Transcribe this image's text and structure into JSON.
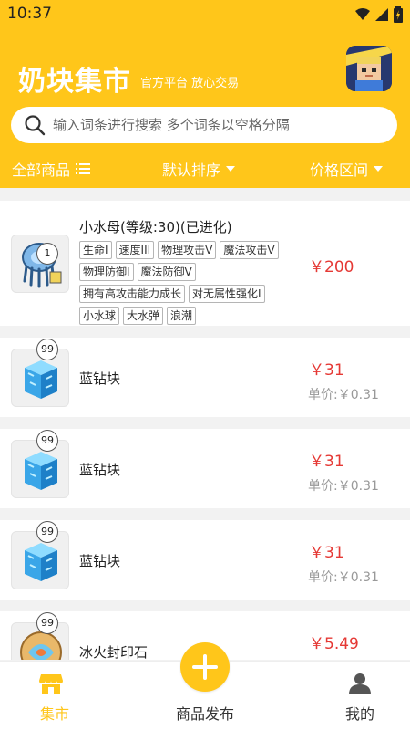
{
  "status_bar": {
    "time": "10:37"
  },
  "header": {
    "title": "奶块集市",
    "subtitle": "官方平台 放心交易",
    "avatar_icon": "player-avatar"
  },
  "search": {
    "placeholder": "输入词条进行搜索 多个词条以空格分隔",
    "value": ""
  },
  "filters": {
    "all": "全部商品",
    "sort": "默认排序",
    "price": "价格区间"
  },
  "products": [
    {
      "name": "小水母(等级:30)(已进化)",
      "qty": "1",
      "icon": "jellyfish-pet-icon",
      "tags": [
        "生命I",
        "速度III",
        "物理攻击V",
        "魔法攻击V",
        "物理防御I",
        "魔法防御V",
        "拥有高攻击能力成长",
        "对无属性强化I",
        "小水球",
        "大水弹",
        "浪潮"
      ],
      "price": "￥200"
    },
    {
      "name": "蓝钻块",
      "qty": "99",
      "icon": "blue-diamond-block-icon",
      "price": "￥31",
      "unit_price": "单价:￥0.31"
    },
    {
      "name": "蓝钻块",
      "qty": "99",
      "icon": "blue-diamond-block-icon",
      "price": "￥31",
      "unit_price": "单价:￥0.31"
    },
    {
      "name": "蓝钻块",
      "qty": "99",
      "icon": "blue-diamond-block-icon",
      "price": "￥31",
      "unit_price": "单价:￥0.31"
    },
    {
      "name": "冰火封印石",
      "qty": "99",
      "icon": "ice-fire-seal-stone-icon",
      "price": "￥5.49"
    }
  ],
  "bottom_nav": {
    "market": "集市",
    "publish": "商品发布",
    "mine": "我的"
  },
  "colors": {
    "accent": "#ffc61a",
    "price": "#e53935",
    "muted": "#999999"
  }
}
